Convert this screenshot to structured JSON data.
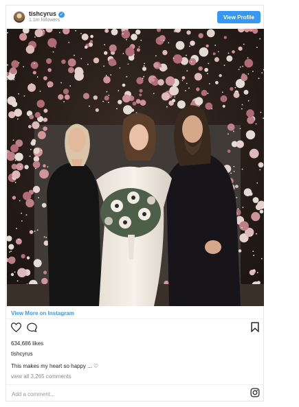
{
  "post": {
    "username": "tishcyrus",
    "verified_glyph": "✓",
    "followers": "1.1m followers",
    "view_profile_label": "View Profile",
    "view_more_label": "View More on Instagram",
    "likes": "634,686 likes",
    "owner": "tishcyrus",
    "caption": "This makes my heart so happy ... ♡",
    "view_comments": "view all 3,265 comments",
    "comment_placeholder": "Add a comment..."
  },
  "icons": {
    "avatar": "avatar",
    "verified": "verified-badge-icon",
    "like": "heart-icon",
    "comment": "comment-icon",
    "save": "bookmark-icon",
    "logo": "instagram-icon"
  },
  "colors": {
    "accent": "#3897f0",
    "text": "#262626",
    "muted": "#8e8e8e"
  }
}
